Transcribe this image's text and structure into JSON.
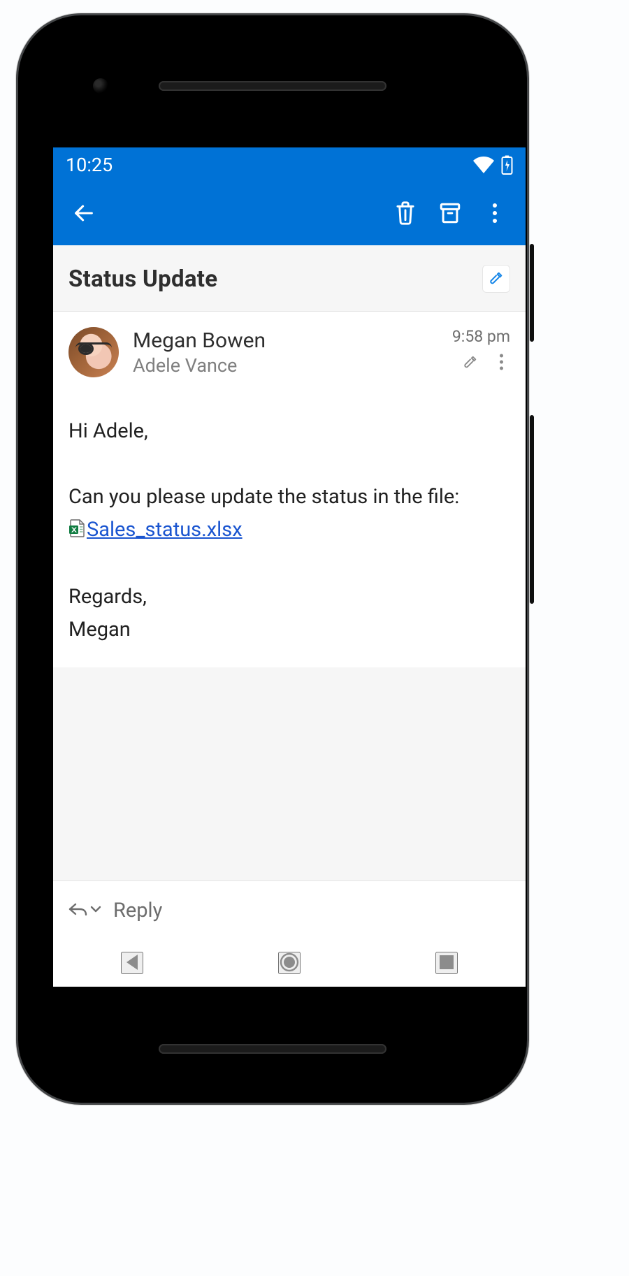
{
  "status_bar": {
    "time": "10:25"
  },
  "toolbar": {
    "back_name": "back-icon",
    "delete_name": "trash-icon",
    "archive_name": "archive-icon",
    "more_name": "more-vertical-icon"
  },
  "subject": {
    "title": "Status Update"
  },
  "message": {
    "sender": "Megan Bowen",
    "recipient": "Adele Vance",
    "time": "9:58 pm",
    "body": {
      "greeting": "Hi Adele,",
      "line1": "Can you please update the status in the file: ",
      "file_name": "Sales_status.xlsx",
      "closing1": "Regards,",
      "closing2": "Megan"
    }
  },
  "reply": {
    "label": "Reply"
  }
}
